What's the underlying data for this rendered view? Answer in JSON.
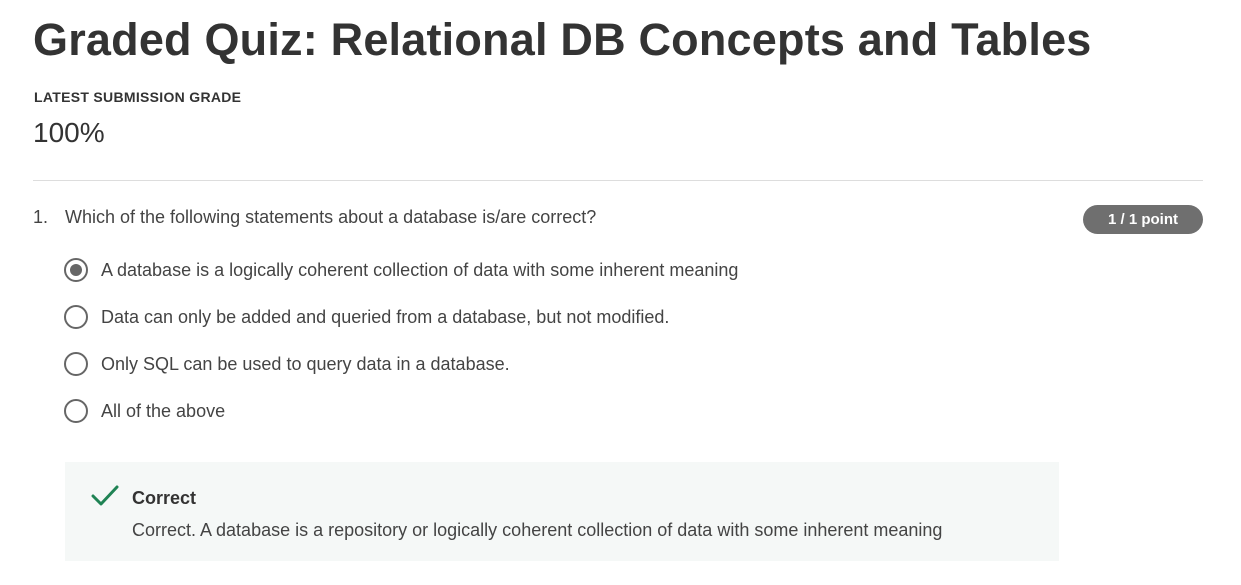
{
  "page": {
    "title": "Graded Quiz: Relational DB Concepts and Tables",
    "grade_label": "LATEST SUBMISSION GRADE",
    "grade_value": "100%"
  },
  "question": {
    "number": "1.",
    "text": "Which of the following statements about a database is/are correct?",
    "points": "1 / 1 point",
    "options": [
      {
        "label": "A database is a logically coherent collection of data with some inherent meaning",
        "selected": true
      },
      {
        "label": "Data can only be added and queried from a database, but not modified.",
        "selected": false
      },
      {
        "label": "Only SQL can be used to query data in a database.",
        "selected": false
      },
      {
        "label": "All of the above",
        "selected": false
      }
    ],
    "feedback": {
      "icon": "checkmark-icon",
      "title": "Correct",
      "text": "Correct. A database is a repository or logically coherent collection of data with some inherent meaning"
    }
  },
  "colors": {
    "correct_green": "#1f8354",
    "badge_gray": "#6f6f6f",
    "feedback_bg": "#f5f8f7"
  }
}
